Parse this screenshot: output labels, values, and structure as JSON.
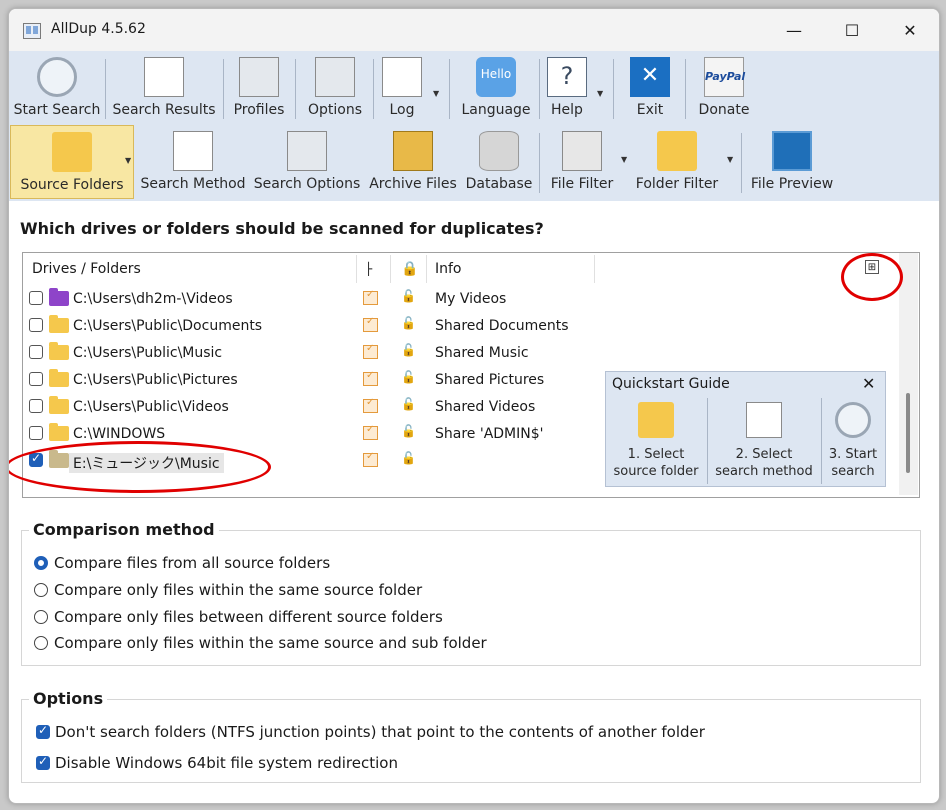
{
  "window": {
    "title": "AllDup 4.5.62"
  },
  "toolbar_row1": [
    {
      "label": "Start Search"
    },
    {
      "label": "Search Results"
    },
    {
      "label": "Profiles"
    },
    {
      "label": "Options"
    },
    {
      "label": "Log"
    },
    {
      "label": "Language",
      "icon_text": "Hello"
    },
    {
      "label": "Help",
      "icon_text": "?"
    },
    {
      "label": "Exit",
      "icon_text": "✕"
    },
    {
      "label": "Donate",
      "icon_text": "PayPal"
    }
  ],
  "toolbar_row2": [
    {
      "label": "Source Folders",
      "selected": true
    },
    {
      "label": "Search Method"
    },
    {
      "label": "Search Options"
    },
    {
      "label": "Archive Files"
    },
    {
      "label": "Database"
    },
    {
      "label": "File Filter"
    },
    {
      "label": "Folder Filter"
    },
    {
      "label": "File Preview"
    }
  ],
  "main": {
    "heading": "Which drives or folders should be scanned for duplicates?",
    "columns": {
      "drives": "Drives / Folders",
      "info": "Info"
    },
    "folders": [
      {
        "path": "C:\\Users\\dh2m-\\Videos",
        "info": "My Videos",
        "checked": false
      },
      {
        "path": "C:\\Users\\Public\\Documents",
        "info": "Shared Documents",
        "checked": false
      },
      {
        "path": "C:\\Users\\Public\\Music",
        "info": "Shared Music",
        "checked": false
      },
      {
        "path": "C:\\Users\\Public\\Pictures",
        "info": "Shared Pictures",
        "checked": false
      },
      {
        "path": "C:\\Users\\Public\\Videos",
        "info": "Shared Videos",
        "checked": false
      },
      {
        "path": "C:\\WINDOWS",
        "info": "Share 'ADMIN$'",
        "checked": false
      },
      {
        "path": "E:\\ミュージック\\Music",
        "info": "",
        "checked": true
      }
    ]
  },
  "quickstart": {
    "title": "Quickstart Guide",
    "steps": [
      {
        "line1": "1. Select",
        "line2": "source folder"
      },
      {
        "line1": "2. Select",
        "line2": "search method"
      },
      {
        "line1": "3. Start",
        "line2": "search"
      }
    ]
  },
  "comparison": {
    "title": "Comparison method",
    "options": [
      {
        "label": "Compare files from all source folders",
        "selected": true
      },
      {
        "label": "Compare only files within the same source folder",
        "selected": false
      },
      {
        "label": "Compare only files between different source folders",
        "selected": false
      },
      {
        "label": "Compare only files within the same source and sub folder",
        "selected": false
      }
    ]
  },
  "options": {
    "title": "Options",
    "items": [
      {
        "label": "Don't search folders (NTFS junction points) that point to the contents of another folder",
        "checked": true
      },
      {
        "label": "Disable Windows 64bit file system redirection",
        "checked": true
      }
    ]
  },
  "colors": {
    "accent": "#1f5fb8",
    "toolbar_bg": "#dde6f2",
    "annotation": "#e00000",
    "selected_tab": "#f8e7a3"
  }
}
